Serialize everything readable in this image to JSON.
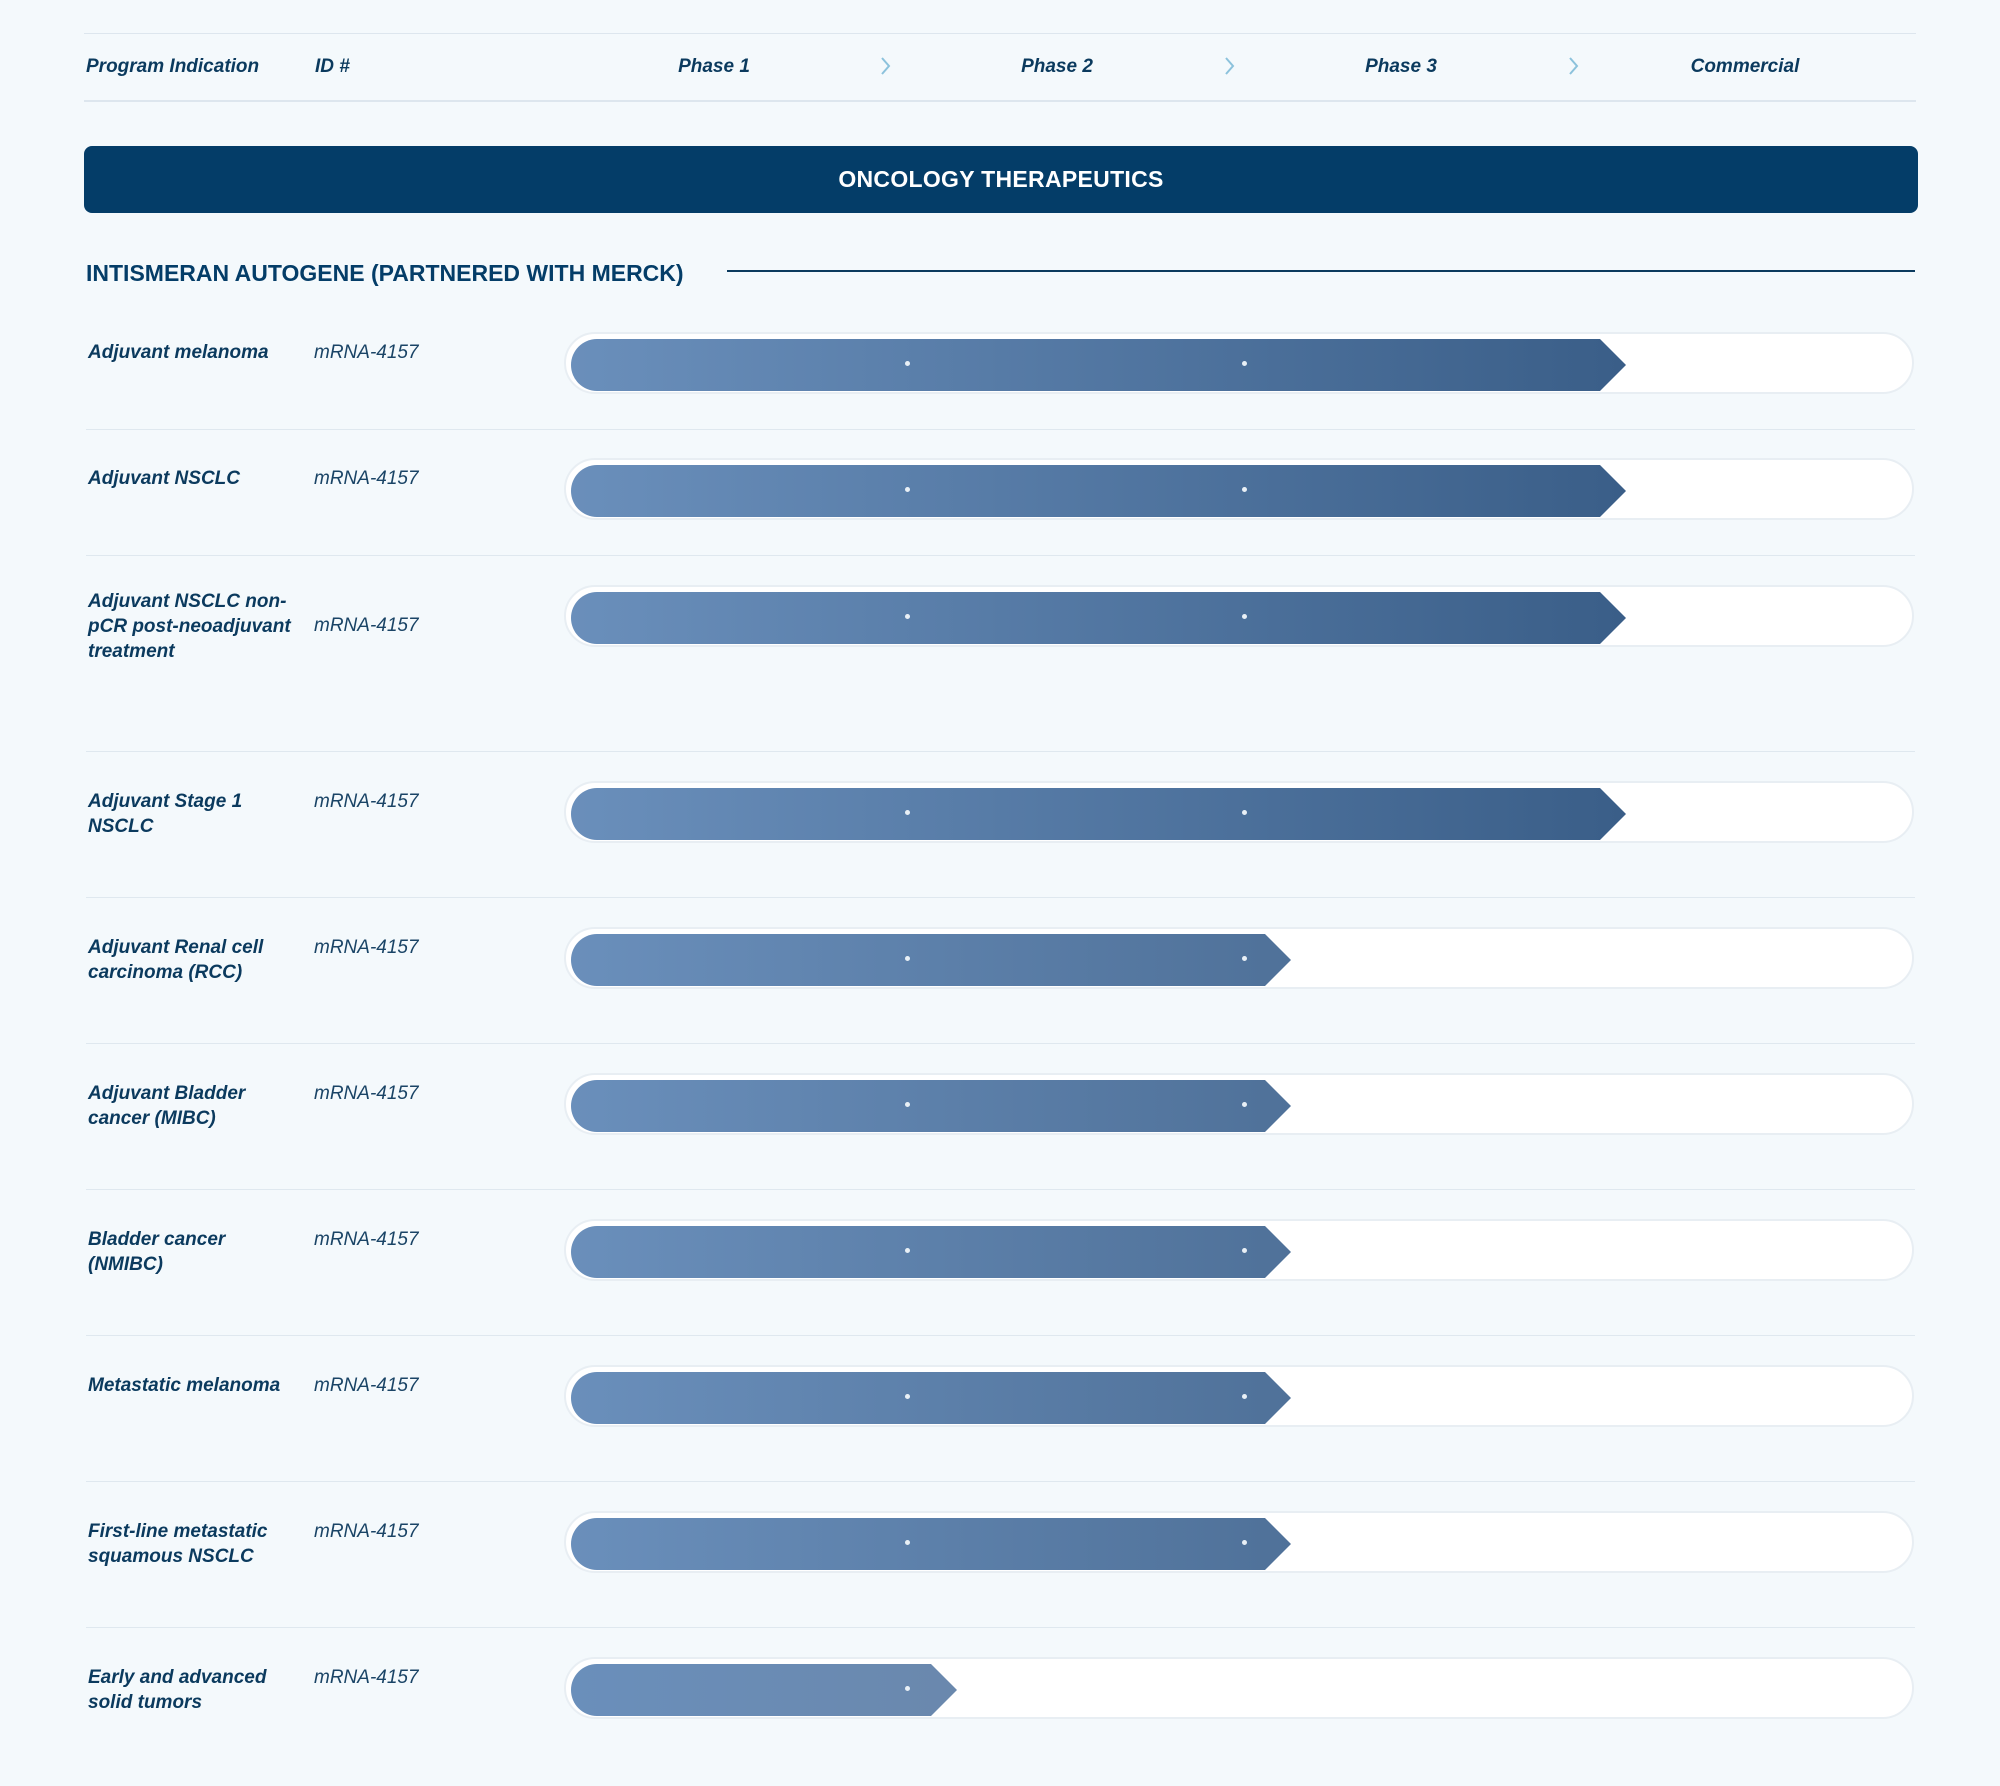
{
  "header": {
    "program_indication": "Program Indication",
    "id": "ID #",
    "phases": [
      "Phase 1",
      "Phase 2",
      "Phase 3",
      "Commercial"
    ]
  },
  "banner": {
    "title": "ONCOLOGY THERAPEUTICS"
  },
  "section": {
    "title": "INTISMERAN AUTOGENE (PARTNERED WITH MERCK)"
  },
  "colors": {
    "banner": "#043d68",
    "bar_start": "#6a8fbb",
    "bar_end": "#3a5e88",
    "text": "#0b3a5e"
  },
  "programs": [
    {
      "indication": "Adjuvant melanoma",
      "id": "mRNA-4157",
      "stage": 3
    },
    {
      "indication": "Adjuvant NSCLC",
      "id": "mRNA-4157",
      "stage": 3
    },
    {
      "indication": "Adjuvant NSCLC non-pCR post-neoadjuvant treatment",
      "id": "mRNA-4157",
      "stage": 3
    },
    {
      "indication": "Adjuvant Stage 1 NSCLC",
      "id": "mRNA-4157",
      "stage": 3
    },
    {
      "indication": "Adjuvant Renal cell carcinoma (RCC)",
      "id": "mRNA-4157",
      "stage": 2
    },
    {
      "indication": "Adjuvant Bladder cancer (MIBC)",
      "id": "mRNA-4157",
      "stage": 2
    },
    {
      "indication": "Bladder cancer (NMIBC)",
      "id": "mRNA-4157",
      "stage": 2
    },
    {
      "indication": "Metastatic melanoma",
      "id": "mRNA-4157",
      "stage": 2
    },
    {
      "indication": "First-line metastatic squamous NSCLC",
      "id": "mRNA-4157",
      "stage": 2
    },
    {
      "indication": "Early and advanced solid tumors",
      "id": "mRNA-4157",
      "stage": 1
    }
  ]
}
